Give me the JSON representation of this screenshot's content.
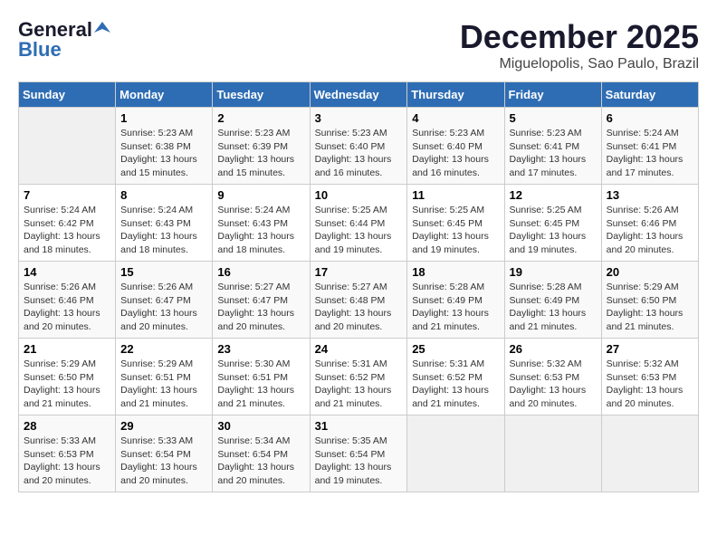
{
  "header": {
    "logo_line1": "General",
    "logo_line2": "Blue",
    "main_title": "December 2025",
    "subtitle": "Miguelopolis, Sao Paulo, Brazil"
  },
  "days_of_week": [
    "Sunday",
    "Monday",
    "Tuesday",
    "Wednesday",
    "Thursday",
    "Friday",
    "Saturday"
  ],
  "weeks": [
    [
      {
        "day": "",
        "info": ""
      },
      {
        "day": "1",
        "info": "Sunrise: 5:23 AM\nSunset: 6:38 PM\nDaylight: 13 hours\nand 15 minutes."
      },
      {
        "day": "2",
        "info": "Sunrise: 5:23 AM\nSunset: 6:39 PM\nDaylight: 13 hours\nand 15 minutes."
      },
      {
        "day": "3",
        "info": "Sunrise: 5:23 AM\nSunset: 6:40 PM\nDaylight: 13 hours\nand 16 minutes."
      },
      {
        "day": "4",
        "info": "Sunrise: 5:23 AM\nSunset: 6:40 PM\nDaylight: 13 hours\nand 16 minutes."
      },
      {
        "day": "5",
        "info": "Sunrise: 5:23 AM\nSunset: 6:41 PM\nDaylight: 13 hours\nand 17 minutes."
      },
      {
        "day": "6",
        "info": "Sunrise: 5:24 AM\nSunset: 6:41 PM\nDaylight: 13 hours\nand 17 minutes."
      }
    ],
    [
      {
        "day": "7",
        "info": "Sunrise: 5:24 AM\nSunset: 6:42 PM\nDaylight: 13 hours\nand 18 minutes."
      },
      {
        "day": "8",
        "info": "Sunrise: 5:24 AM\nSunset: 6:43 PM\nDaylight: 13 hours\nand 18 minutes."
      },
      {
        "day": "9",
        "info": "Sunrise: 5:24 AM\nSunset: 6:43 PM\nDaylight: 13 hours\nand 18 minutes."
      },
      {
        "day": "10",
        "info": "Sunrise: 5:25 AM\nSunset: 6:44 PM\nDaylight: 13 hours\nand 19 minutes."
      },
      {
        "day": "11",
        "info": "Sunrise: 5:25 AM\nSunset: 6:45 PM\nDaylight: 13 hours\nand 19 minutes."
      },
      {
        "day": "12",
        "info": "Sunrise: 5:25 AM\nSunset: 6:45 PM\nDaylight: 13 hours\nand 19 minutes."
      },
      {
        "day": "13",
        "info": "Sunrise: 5:26 AM\nSunset: 6:46 PM\nDaylight: 13 hours\nand 20 minutes."
      }
    ],
    [
      {
        "day": "14",
        "info": "Sunrise: 5:26 AM\nSunset: 6:46 PM\nDaylight: 13 hours\nand 20 minutes."
      },
      {
        "day": "15",
        "info": "Sunrise: 5:26 AM\nSunset: 6:47 PM\nDaylight: 13 hours\nand 20 minutes."
      },
      {
        "day": "16",
        "info": "Sunrise: 5:27 AM\nSunset: 6:47 PM\nDaylight: 13 hours\nand 20 minutes."
      },
      {
        "day": "17",
        "info": "Sunrise: 5:27 AM\nSunset: 6:48 PM\nDaylight: 13 hours\nand 20 minutes."
      },
      {
        "day": "18",
        "info": "Sunrise: 5:28 AM\nSunset: 6:49 PM\nDaylight: 13 hours\nand 21 minutes."
      },
      {
        "day": "19",
        "info": "Sunrise: 5:28 AM\nSunset: 6:49 PM\nDaylight: 13 hours\nand 21 minutes."
      },
      {
        "day": "20",
        "info": "Sunrise: 5:29 AM\nSunset: 6:50 PM\nDaylight: 13 hours\nand 21 minutes."
      }
    ],
    [
      {
        "day": "21",
        "info": "Sunrise: 5:29 AM\nSunset: 6:50 PM\nDaylight: 13 hours\nand 21 minutes."
      },
      {
        "day": "22",
        "info": "Sunrise: 5:29 AM\nSunset: 6:51 PM\nDaylight: 13 hours\nand 21 minutes."
      },
      {
        "day": "23",
        "info": "Sunrise: 5:30 AM\nSunset: 6:51 PM\nDaylight: 13 hours\nand 21 minutes."
      },
      {
        "day": "24",
        "info": "Sunrise: 5:31 AM\nSunset: 6:52 PM\nDaylight: 13 hours\nand 21 minutes."
      },
      {
        "day": "25",
        "info": "Sunrise: 5:31 AM\nSunset: 6:52 PM\nDaylight: 13 hours\nand 21 minutes."
      },
      {
        "day": "26",
        "info": "Sunrise: 5:32 AM\nSunset: 6:53 PM\nDaylight: 13 hours\nand 20 minutes."
      },
      {
        "day": "27",
        "info": "Sunrise: 5:32 AM\nSunset: 6:53 PM\nDaylight: 13 hours\nand 20 minutes."
      }
    ],
    [
      {
        "day": "28",
        "info": "Sunrise: 5:33 AM\nSunset: 6:53 PM\nDaylight: 13 hours\nand 20 minutes."
      },
      {
        "day": "29",
        "info": "Sunrise: 5:33 AM\nSunset: 6:54 PM\nDaylight: 13 hours\nand 20 minutes."
      },
      {
        "day": "30",
        "info": "Sunrise: 5:34 AM\nSunset: 6:54 PM\nDaylight: 13 hours\nand 20 minutes."
      },
      {
        "day": "31",
        "info": "Sunrise: 5:35 AM\nSunset: 6:54 PM\nDaylight: 13 hours\nand 19 minutes."
      },
      {
        "day": "",
        "info": ""
      },
      {
        "day": "",
        "info": ""
      },
      {
        "day": "",
        "info": ""
      }
    ]
  ]
}
